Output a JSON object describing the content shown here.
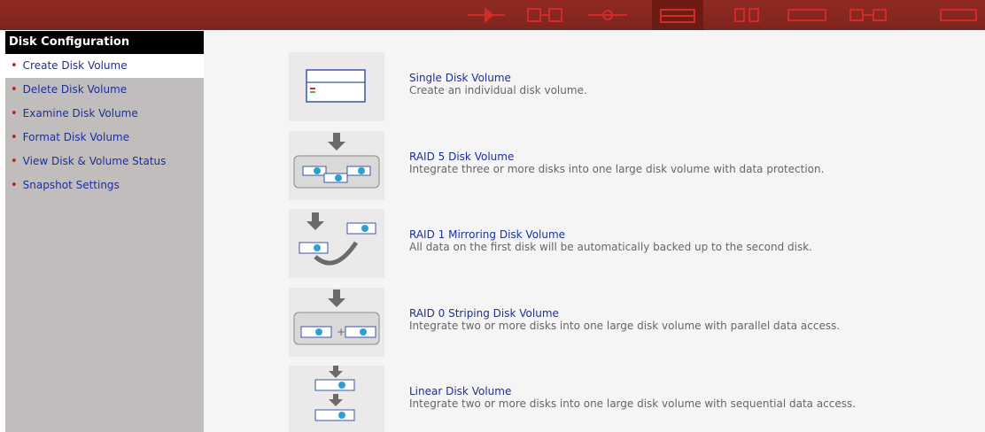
{
  "sidebar": {
    "header": "Disk Configuration",
    "items": [
      {
        "label": "Create Disk Volume"
      },
      {
        "label": "Delete Disk Volume"
      },
      {
        "label": "Examine Disk Volume"
      },
      {
        "label": "Format Disk Volume"
      },
      {
        "label": "View Disk & Volume Status"
      },
      {
        "label": "Snapshot Settings"
      }
    ]
  },
  "options": [
    {
      "title": "Single Disk Volume",
      "description": "Create an individual disk volume.",
      "icon": "single-disk-icon"
    },
    {
      "title": "RAID 5 Disk Volume",
      "description": "Integrate three or more disks into one large disk volume with data protection.",
      "icon": "raid5-icon"
    },
    {
      "title": "RAID 1 Mirroring Disk Volume",
      "description": "All data on the first disk will be automatically backed up to the second disk.",
      "icon": "raid1-icon"
    },
    {
      "title": "RAID 0 Striping Disk Volume",
      "description": "Integrate two or more disks into one large disk volume with parallel data access.",
      "icon": "raid0-icon"
    },
    {
      "title": "Linear Disk Volume",
      "description": "Integrate two or more disks into one large disk volume with sequential data access.",
      "icon": "linear-disk-icon"
    }
  ],
  "colors": {
    "topbar": "#8a2820",
    "accent": "#c0191b",
    "link": "#1c2f9c",
    "sidebar": "#c0bdbc"
  }
}
